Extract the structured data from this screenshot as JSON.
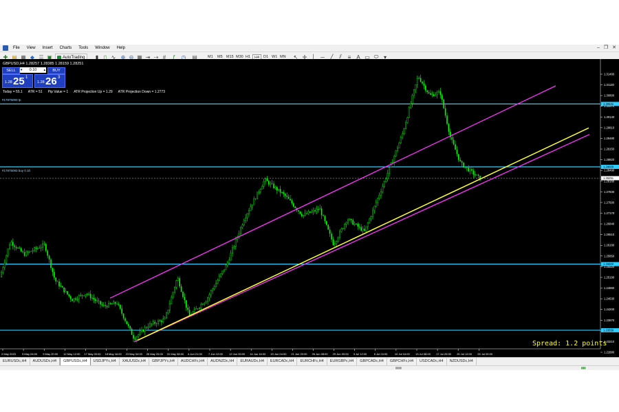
{
  "menu": [
    "File",
    "View",
    "Insert",
    "Charts",
    "Tools",
    "Window",
    "Help"
  ],
  "toolbar": {
    "autotrading": "AutoTrading",
    "timeframes": [
      "M1",
      "M5",
      "M15",
      "M30",
      "H1",
      "H4",
      "D1",
      "W1",
      "MN"
    ],
    "active_timeframe": "H4"
  },
  "chart": {
    "title": "GBPUSD,H4  1.28257 1.28385 1.28159 1.28251",
    "oneclick": {
      "sell_label": "SELL",
      "buy_label": "BUY",
      "lot": "0.10",
      "sell_prefix": "1.28",
      "sell_big": "25",
      "sell_sup": "1",
      "buy_prefix": "1.28",
      "buy_big": "26",
      "buy_sup": "3"
    },
    "stats": [
      "Today = 55.1",
      "ATR = 51",
      "Pip Value = 1",
      "ATR Projection Up = 1.29",
      "ATR Projection Down = 1.2773"
    ],
    "line_labels": [
      "#17875093 tp",
      "#17875093 buy 0.10"
    ],
    "spread": "Spread: 1.2 points",
    "colors": {
      "background": "#000000",
      "candles": "#00ff00",
      "channel": "#ff33ff",
      "trendline": "#ffff33",
      "levels": "#33ccff"
    }
  },
  "price_axis": {
    "ticks": [
      "1.31460",
      "1.31130",
      "1.30800",
      "1.30470",
      "1.30140",
      "1.29810",
      "1.29480",
      "1.29150",
      "1.28820",
      "1.28490",
      "1.28160",
      "1.27830",
      "1.27500",
      "1.27170",
      "1.26840",
      "1.26510",
      "1.26180",
      "1.25850",
      "1.25520",
      "1.25190",
      "1.24860",
      "1.24530",
      "1.24200",
      "1.23870",
      "1.23540",
      "1.23210",
      "1.22880"
    ],
    "level_labels": [
      "1.30541",
      "1.28600",
      "1.25600",
      "1.23559"
    ],
    "current_price": "1.28251"
  },
  "time_axis": [
    "2 May 2023",
    "5 May 04:00",
    "9 May 20:00",
    "12 May 12:00",
    "17 May 00:00",
    "18 May 16:00",
    "23 May 04:00",
    "26 May 20:00",
    "31 May 08:00",
    "4 Jun 21:00",
    "7 Jun 12:00",
    "12 Jun 00:00",
    "14 Jun 16:00",
    "19 Jun 04:00",
    "21 Jun 20:00",
    "26 Jun 08:00",
    "29 Jun 00:00",
    "3 Jul 12:00",
    "6 Jul 04:00",
    "10 Jul 16:00",
    "13 Jul 08:00",
    "17 Jul 20:00",
    "20 Jul 12:00",
    "25 Jul 00:00"
  ],
  "tabs": [
    "EURUSDc,H4",
    "AUDUSDc,H4",
    "GBPUSDc,H4",
    "USDJPYc,H4",
    "XAUUSDc,H4",
    "GBPJPYc,H4",
    "AUDCHFc,H4",
    "AUDNZDc,H4",
    "EURAUDc,H4",
    "EURCADc,H4",
    "EURCHFc,H4",
    "EURGBPc,H4",
    "GBPCADc,H4",
    "GBPCHFc,H4",
    "USDCADc,H4",
    "NZDUSDc,H4"
  ],
  "active_tab": "GBPUSDc,H4"
}
